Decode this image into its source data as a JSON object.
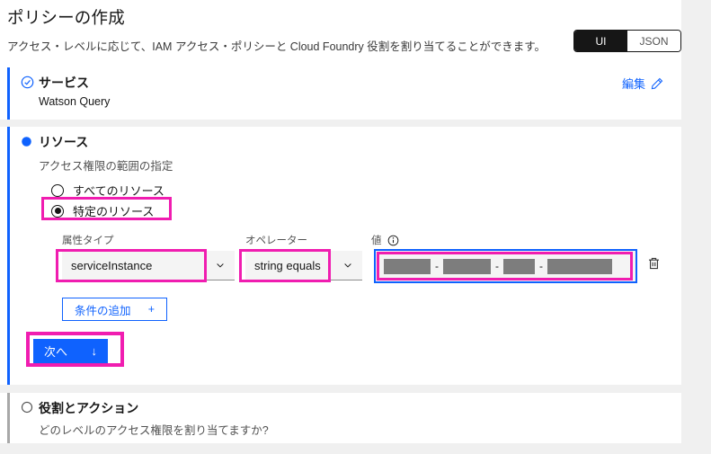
{
  "page": {
    "title": "ポリシーの作成",
    "subtitle": "アクセス・レベルに応じて、IAM アクセス・ポリシーと Cloud Foundry 役割を割り当てることができます。"
  },
  "view_switcher": {
    "options": [
      {
        "label": "UI",
        "selected": true
      },
      {
        "label": "JSON",
        "selected": false
      }
    ]
  },
  "service_section": {
    "status_icon": "checkmark-outline-icon",
    "title": "サービス",
    "selected_service": "Watson Query",
    "edit_label": "編集",
    "edit_icon": "pencil-icon"
  },
  "resource_section": {
    "status_icon": "filled-circle-icon",
    "title": "リソース",
    "subtitle": "アクセス権限の範囲の指定",
    "radios": [
      {
        "label": "すべてのリソース",
        "selected": false
      },
      {
        "label": "特定のリソース",
        "selected": true,
        "annotated": true
      }
    ],
    "condition_row": {
      "attribute_type": {
        "label": "属性タイプ",
        "value": "serviceInstance",
        "icon": "chevron-down-icon"
      },
      "operator": {
        "label": "オペレーター",
        "value": "string equals",
        "icon": "chevron-down-icon"
      },
      "value": {
        "label": "値",
        "info_icon": "information-icon",
        "redacted": true,
        "redacted_segments": 4,
        "separator": "-",
        "focused": true
      },
      "delete_icon": "trash-can-icon"
    },
    "add_condition_button": {
      "label": "条件の追加",
      "icon_label": "+"
    },
    "next_button": {
      "label": "次へ",
      "icon_label": "↓",
      "annotated": true
    }
  },
  "roles_section": {
    "status_icon": "empty-circle-icon",
    "title": "役割とアクション",
    "subtitle": "どのレベルのアクセス権限を割り当てますか?"
  },
  "colors": {
    "accent_blue": "#0f62fe",
    "annotation_magenta": "#f01db0",
    "switcher_selected_bg": "#161616",
    "field_background": "#f4f4f4",
    "page_margin_gray": "#f0f0f0",
    "redaction_gray": "#7d7d7d",
    "inactive_border_gray": "#a8a8a8"
  }
}
